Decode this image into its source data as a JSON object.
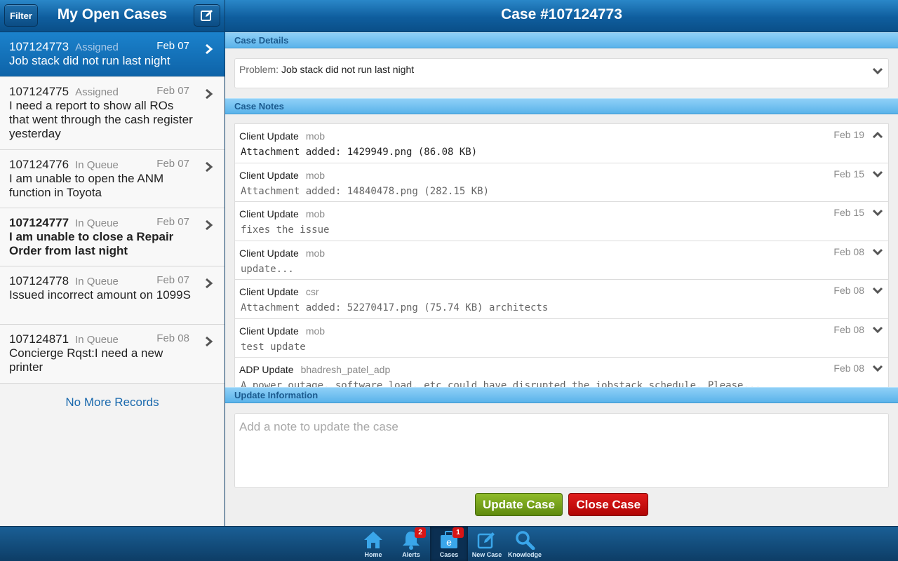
{
  "left": {
    "title": "My Open Cases",
    "filter_label": "Filter",
    "cases": [
      {
        "number": "107124773",
        "status": "Assigned",
        "date": "Feb 07",
        "desc": "Job stack did not run last night"
      },
      {
        "number": "107124775",
        "status": "Assigned",
        "date": "Feb 07",
        "desc": "I need a report to show all ROs that went through the cash register yesterday"
      },
      {
        "number": "107124776",
        "status": "In Queue",
        "date": "Feb 07",
        "desc": "I am unable to open the ANM function in Toyota"
      },
      {
        "number": "107124777",
        "status": "In Queue",
        "date": "Feb 07",
        "desc": "I am unable to close a Repair Order from last night"
      },
      {
        "number": "107124778",
        "status": "In Queue",
        "date": "Feb 07",
        "desc": "Issued incorrect amount on 1099S"
      },
      {
        "number": "107124871",
        "status": "In Queue",
        "date": "Feb 08",
        "desc": "Concierge Rqst:I need a new printer"
      }
    ],
    "no_more": "No More Records"
  },
  "right": {
    "title": "Case #107124773",
    "details_heading": "Case Details",
    "problem_label": "Problem:",
    "problem_value": "Job stack did not run last night",
    "notes_heading": "Case Notes",
    "notes": [
      {
        "type": "Client Update",
        "author": "mob",
        "date": "Feb 19",
        "body": "Attachment added: 1429949.png (86.08 KB)"
      },
      {
        "type": "Client Update",
        "author": "mob",
        "date": "Feb 15",
        "body": "Attachment added: 14840478.png (282.15 KB)"
      },
      {
        "type": "Client Update",
        "author": "mob",
        "date": "Feb 15",
        "body": "fixes the issue"
      },
      {
        "type": "Client Update",
        "author": "mob",
        "date": "Feb 08",
        "body": "update..."
      },
      {
        "type": "Client Update",
        "author": "csr",
        "date": "Feb 08",
        "body": "Attachment added: 52270417.png (75.74 KB) architects"
      },
      {
        "type": "Client Update",
        "author": "mob",
        "date": "Feb 08",
        "body": "test update"
      },
      {
        "type": "ADP Update",
        "author": "bhadresh_patel_adp",
        "date": "Feb 08",
        "body": "A power outage, software load, etc could have disrupted the jobstack schedule. Please..."
      }
    ],
    "update_heading": "Update Information",
    "update_placeholder": "Add a note to update the case",
    "update_button": "Update Case",
    "close_button": "Close Case"
  },
  "tabbar": {
    "tabs": [
      {
        "label": "Home",
        "icon": "home-icon"
      },
      {
        "label": "Alerts",
        "icon": "bell-icon",
        "badge": "2"
      },
      {
        "label": "Cases",
        "icon": "briefcase-icon",
        "badge": "1"
      },
      {
        "label": "New Case",
        "icon": "compose-icon"
      },
      {
        "label": "Knowledge",
        "icon": "search-icon"
      }
    ]
  },
  "colors": {
    "header_blue": "#0f5e9e",
    "section_blue": "#5ab3ea",
    "update_green": "#6f9a14",
    "close_red": "#c80a0a",
    "link_blue": "#1a69ad"
  }
}
